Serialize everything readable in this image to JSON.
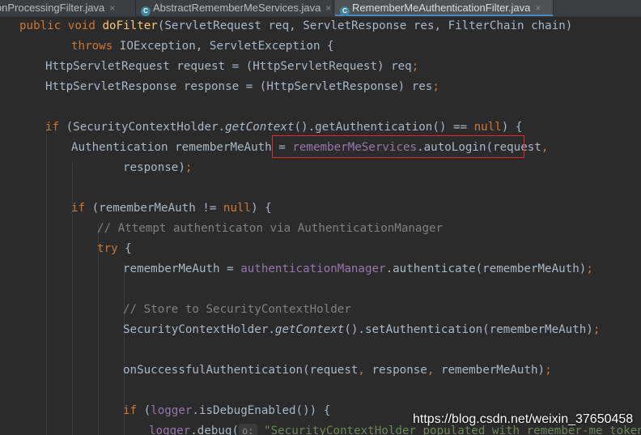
{
  "tabs": [
    {
      "label": "ionProcessingFilter.java",
      "close": "×",
      "active": false
    },
    {
      "label": "AbstractRememberMeServices.java",
      "close": "×",
      "active": false
    },
    {
      "label": "RememberMeAuthenticationFilter.java",
      "close": "×",
      "active": true
    }
  ],
  "code": {
    "l1": {
      "a": "public void ",
      "b": "doFilter",
      "c": "(ServletRequest req, ServletResponse res, FilterChain chain)"
    },
    "l2": {
      "a": "throws ",
      "b": "IOException, ServletException {"
    },
    "l3": {
      "a": "HttpServletRequest request = (HttpServletRequest) req",
      "b": ";"
    },
    "l4": {
      "a": "HttpServletResponse response = (HttpServletResponse) res",
      "b": ";"
    },
    "l5": {
      "a": "if ",
      "b": "(SecurityContextHolder.",
      "c": "getContext",
      "d": "().getAuthentication() == ",
      "e": "null",
      "f": ") {"
    },
    "l6": {
      "a": "Authentication rememberMeAuth = ",
      "b": "rememberMeServices",
      "c": ".autoLogin(request",
      "d": ","
    },
    "l7": {
      "a": "response)",
      "b": ";"
    },
    "l8": {
      "a": "if ",
      "b": "(rememberMeAuth != ",
      "c": "null",
      "d": ") {"
    },
    "l9": {
      "a": "// Attempt authenticaton via AuthenticationManager"
    },
    "l10": {
      "a": "try ",
      "b": "{"
    },
    "l11": {
      "a": "rememberMeAuth = ",
      "b": "authenticationManager",
      "c": ".authenticate(rememberMeAuth)",
      "d": ";"
    },
    "l12": {
      "a": "// Store to SecurityContextHolder"
    },
    "l13": {
      "a": "SecurityContextHolder.",
      "b": "getContext",
      "c": "().setAuthentication(rememberMeAuth)",
      "d": ";"
    },
    "l14": {
      "a": "onSuccessfulAuthentication(request",
      "b": ", ",
      "c": "response",
      "d": ", ",
      "e": "rememberMeAuth)",
      "f": ";"
    },
    "l15": {
      "a": "if ",
      "b": "(",
      "c": "logger",
      "d": ".isDebugEnabled()) {"
    },
    "l16": {
      "a": "logger",
      "b": ".debug(",
      "hint": "o:",
      "c": " \"SecurityContextHolder populated with remember-me token: '\""
    }
  },
  "watermark": "https://blog.csdn.net/weixin_37650458",
  "colors": {
    "keyword": "#cc7832",
    "method": "#ffc66d",
    "field": "#9876aa",
    "comment": "#808080",
    "string": "#6a8759",
    "highlight_box": "#e0282e"
  }
}
